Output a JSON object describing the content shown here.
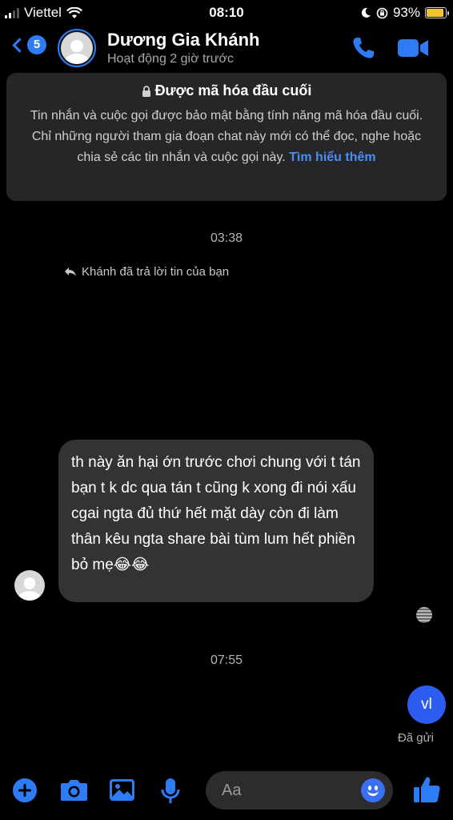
{
  "status_bar": {
    "carrier": "Viettel",
    "time": "08:10",
    "battery_percent": "93%",
    "battery_level": 0.93
  },
  "header": {
    "back_count": "5",
    "contact_name": "Dương Gia Khánh",
    "activity_status": "Hoạt động 2 giờ trước",
    "accent_color": "#2d7cf6"
  },
  "encryption_notice": {
    "title": "Được mã hóa đầu cuối",
    "body": "Tin nhắn và cuộc gọi được bảo mật bằng tính năng mã hóa đầu cuối. Chỉ những người tham gia đoạn chat này mới có thể đọc, nghe hoặc chia sẻ các tin nhắn và cuộc gọi này.",
    "link": "Tìm hiểu thêm"
  },
  "conversation": {
    "timestamp_1": "03:38",
    "reply_note": "Khánh đã trả lời tin của bạn",
    "incoming_message": "th này ăn hại ớn trước chơi chung với t tán bạn t k dc qua tán t cũng k xong đi nói xấu cgai ngta đủ thứ hết mặt dày còn đi làm thân kêu ngta share bài tùm lum hết phiền bỏ mẹ😂😂",
    "timestamp_2": "07:55",
    "outgoing_message": "vl",
    "sent_status": "Đã gửi"
  },
  "composer": {
    "placeholder": "Aa",
    "icons": [
      "plus-icon",
      "camera-icon",
      "gallery-icon",
      "microphone-icon",
      "emoji-icon",
      "thumbs-up-icon"
    ]
  }
}
